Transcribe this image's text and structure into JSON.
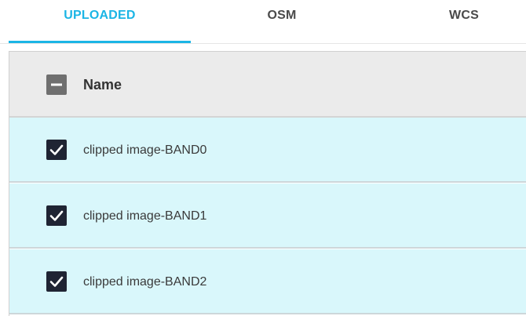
{
  "tabs": [
    {
      "label": "UPLOADED",
      "active": true
    },
    {
      "label": "OSM",
      "active": false
    },
    {
      "label": "WCS",
      "active": false
    }
  ],
  "colors": {
    "accent": "#1bb5e5",
    "row_selected_bg": "#d9f7fb",
    "header_bg": "#ebebeb",
    "checkbox_checked": "#1f2433"
  },
  "grid": {
    "header": {
      "label": "Name",
      "select_all_state": "indeterminate"
    },
    "rows": [
      {
        "label": "clipped image-BAND0",
        "checked": true
      },
      {
        "label": "clipped image-BAND1",
        "checked": true
      },
      {
        "label": "clipped image-BAND2",
        "checked": true
      }
    ]
  }
}
